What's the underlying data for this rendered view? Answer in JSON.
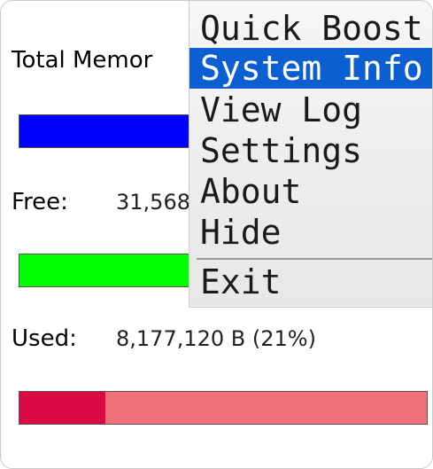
{
  "stats": {
    "total_label": "Total Memor",
    "free_label": "Free:",
    "free_value": "31,568",
    "used_label": "Used:",
    "used_value": "8,177,120 B (21%)"
  },
  "bars": {
    "total": {
      "color": "#0000ff",
      "fraction": 1.0
    },
    "free": {
      "color": "#00ff00",
      "fraction": 1.0
    },
    "used": {
      "fill_color": "#d90a43",
      "track_color": "#f07078",
      "fraction": 0.21
    }
  },
  "menu": {
    "items": [
      {
        "label": "Quick Boost"
      },
      {
        "label": "System Info",
        "selected": true
      },
      {
        "label": "View Log"
      },
      {
        "label": "Settings"
      },
      {
        "label": "About"
      },
      {
        "label": "Hide"
      },
      {
        "label": "Exit"
      }
    ]
  }
}
